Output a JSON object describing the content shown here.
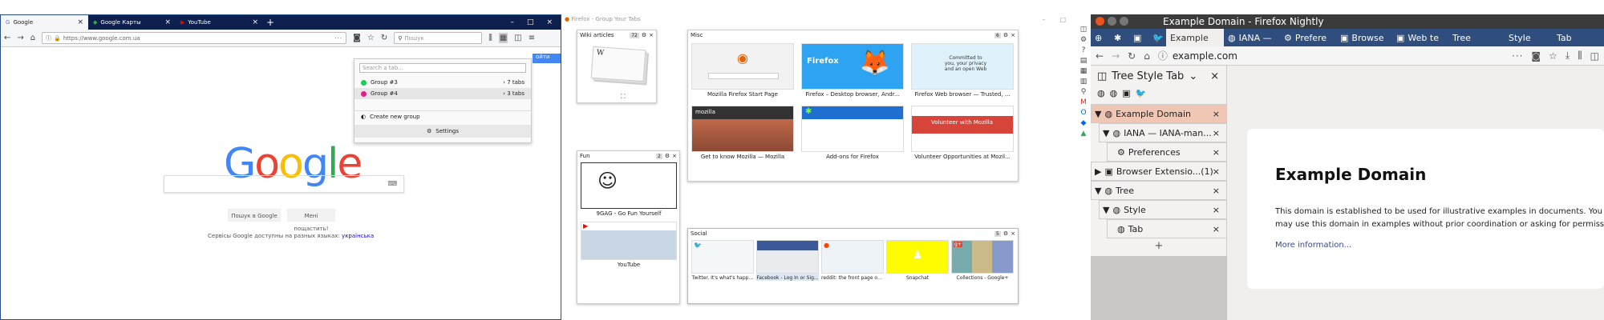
{
  "left": {
    "tabs": [
      {
        "label": "Google"
      },
      {
        "label": "Google Карты"
      },
      {
        "label": "YouTube"
      }
    ],
    "url": "https://www.google.com.ua",
    "search_placeholder": "Пошук",
    "search_tab_placeholder": "Search a tab...",
    "groups": [
      {
        "name": "Group #3",
        "count": "7 tabs",
        "color": "#22c55e"
      },
      {
        "name": "Group #4",
        "count": "3 tabs",
        "color": "#e0218a"
      }
    ],
    "create_group": "Create new group",
    "settings": "Settings",
    "google_btn1": "Пошук в Google",
    "google_btn2": "Мені пощастить!",
    "lang_text": "Сервісы Google доступны на разных языках:",
    "lang_link": "українська",
    "signin_fragment": "ойти"
  },
  "middle": {
    "title": "Firefox - Group Your Tabs",
    "groups": [
      {
        "name": "Wiki articles",
        "count": "72"
      },
      {
        "name": "Misc",
        "count": "6",
        "tabs": [
          "Mozilla Firefox Start Page",
          "Firefox – Desktop browser, Andr...",
          "Firefox Web browser — Trusted, ...",
          "Get to know Mozilla — Mozilla",
          "Add-ons for Firefox",
          "Volunteer Opportunities at Mozil..."
        ]
      },
      {
        "name": "Fun",
        "count": "2",
        "tabs": [
          "9GAG - Go Fun Yourself",
          "YouTube"
        ]
      },
      {
        "name": "Social",
        "count": "5",
        "tabs": [
          "Twitter. It's what's happ...",
          "Facebook - Log In or Sig...",
          "reddit: the front page of ...",
          "Snapchat",
          "Collections - Google+"
        ]
      }
    ],
    "thumb_texts": {
      "firefox": "Firefox",
      "committed": "Committed to you, your privacy and an open Web",
      "mozilla": "mozilla",
      "volunteer": "Volunteer with Mozilla"
    }
  },
  "right": {
    "window_title": "Example Domain - Firefox Nightly",
    "tabs": [
      "Example",
      "IANA —",
      "Prefere",
      "Browse",
      "Web te",
      "Tree",
      "Style",
      "Tab"
    ],
    "url": "example.com",
    "sidebar_title": "Tree Style Tab",
    "tree": [
      "Example Domain",
      "IANA — IANA-man...",
      "Preferences",
      "Browser Extensio...(1)",
      "Tree",
      "Style",
      "Tab"
    ],
    "page_heading": "Example Domain",
    "page_text1": "This domain is established to be used for illustrative examples in documents. You",
    "page_text2": "may use this domain in examples without prior coordination or asking for permission.",
    "page_link": "More information..."
  }
}
